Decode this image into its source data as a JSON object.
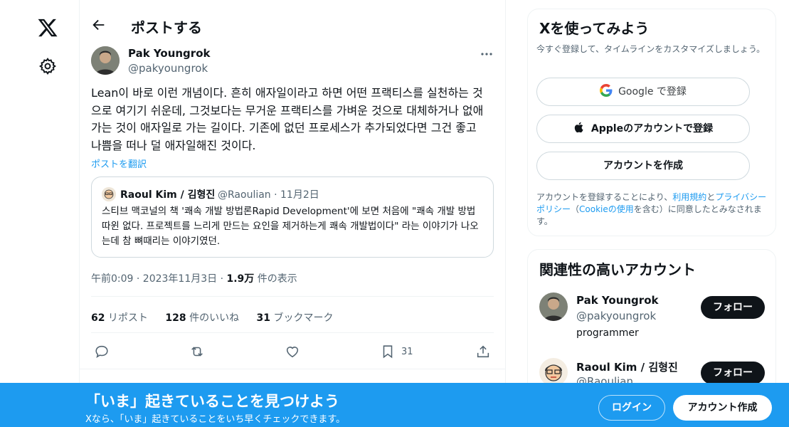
{
  "nav": {
    "logo_icon": "x-logo-icon",
    "settings_icon": "gear-icon"
  },
  "header": {
    "title": "ポストする",
    "back_icon": "arrow-left-icon"
  },
  "post": {
    "author_name": "Pak Youngrok",
    "author_handle": "@pakyoungrok",
    "text": "Lean이 바로 이런 개념이다. 흔히 애자일이라고 하면 어떤 프랙티스를 실천하는 것으로 여기기 쉬운데, 그것보다는 무거운 프랙티스를 가벼운 것으로 대체하거나 없애가는 것이 애자일로 가는 길이다. 기존에 없던 프로세스가 추가되었다면 그건 좋고 나쁨을 떠나 덜 애자일해진 것이다.",
    "translate_label": "ポストを翻訳",
    "quote": {
      "author_name": "Raoul Kim / 김형진",
      "author_handle": "@Raoulian · 11月2日",
      "text": "스티브 맥코널의 책 '쾌속 개발 방법론Rapid Development'에 보면 처음에 \"쾌속 개발 방법 따윈 없다. 프로젝트를 느리게 만드는 요인을 제거하는게 쾌속 개발법이다\" 라는 이야기가 나오는데 참 뼈때리는 이야기였던."
    },
    "time": "午前0:09 · 2023年11月3日 · ",
    "views_count": "1.9万",
    "views_label": " 件の表示",
    "stats": {
      "reposts_count": "62",
      "reposts_label": " リポスト",
      "likes_count": "128",
      "likes_label": " 件のいいね",
      "bookmarks_count": "31",
      "bookmarks_label": " ブックマーク"
    },
    "actions": {
      "reply_icon": "reply-icon",
      "repost_icon": "repost-icon",
      "like_icon": "heart-icon",
      "bookmark_icon": "bookmark-icon",
      "bookmark_count": "31",
      "share_icon": "share-icon"
    }
  },
  "signup_card": {
    "title": "Xを使ってみよう",
    "subtitle": "今すぐ登録して、タイムラインをカスタマイズしましょう。",
    "google_label": "Google で登録",
    "apple_label": "Appleのアカウントで登録",
    "create_label": "アカウントを作成",
    "terms_prefix": "アカウントを登録することにより、",
    "terms_link": "利用規約",
    "terms_and": "と",
    "privacy_link": "プライバシーポリシー",
    "paren_open": "（",
    "cookie_link": "Cookieの使用",
    "terms_suffix": "を含む）に同意したとみなされます。"
  },
  "relevant": {
    "title": "関連性の高いアカウント",
    "accounts": [
      {
        "name": "Pak Youngrok",
        "handle": "@pakyoungrok",
        "bio": "programmer",
        "follow_label": "フォロー"
      },
      {
        "name": "Raoul Kim / 김형진",
        "handle": "@Raoulian",
        "bio": "",
        "follow_label": "フォロー"
      }
    ]
  },
  "banner": {
    "title": "「いま」起きていることを見つけよう",
    "subtitle": "Xなら、「いま」起きていることをいち早くチェックできます。",
    "login_label": "ログイン",
    "signup_label": "アカウント作成"
  },
  "colors": {
    "accent": "#1d9bf0",
    "text": "#0f1419",
    "muted": "#536471",
    "border": "#cfd9de"
  }
}
